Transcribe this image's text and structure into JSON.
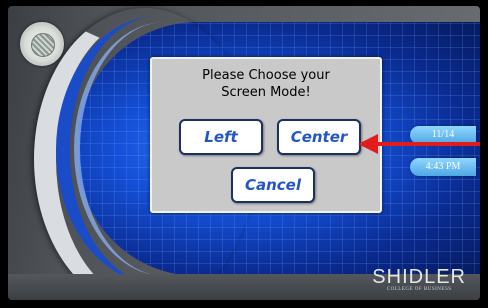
{
  "dialog": {
    "title_line1": "Please Choose your",
    "title_line2": "Screen Mode!",
    "buttons": {
      "left": "Left",
      "center": "Center",
      "cancel": "Cancel"
    }
  },
  "status": {
    "date": "11/14",
    "time": "4:43 PM"
  },
  "branding": {
    "name": "SHIDLER",
    "subtitle": "COLLEGE OF BUSINESS"
  },
  "icons": {
    "seal": "university-seal-icon",
    "arrow": "red-arrow-annotation"
  },
  "colors": {
    "button_text": "#2355c4",
    "arrow": "#e21b1b",
    "dialog_bg": "#c9c9c9"
  }
}
